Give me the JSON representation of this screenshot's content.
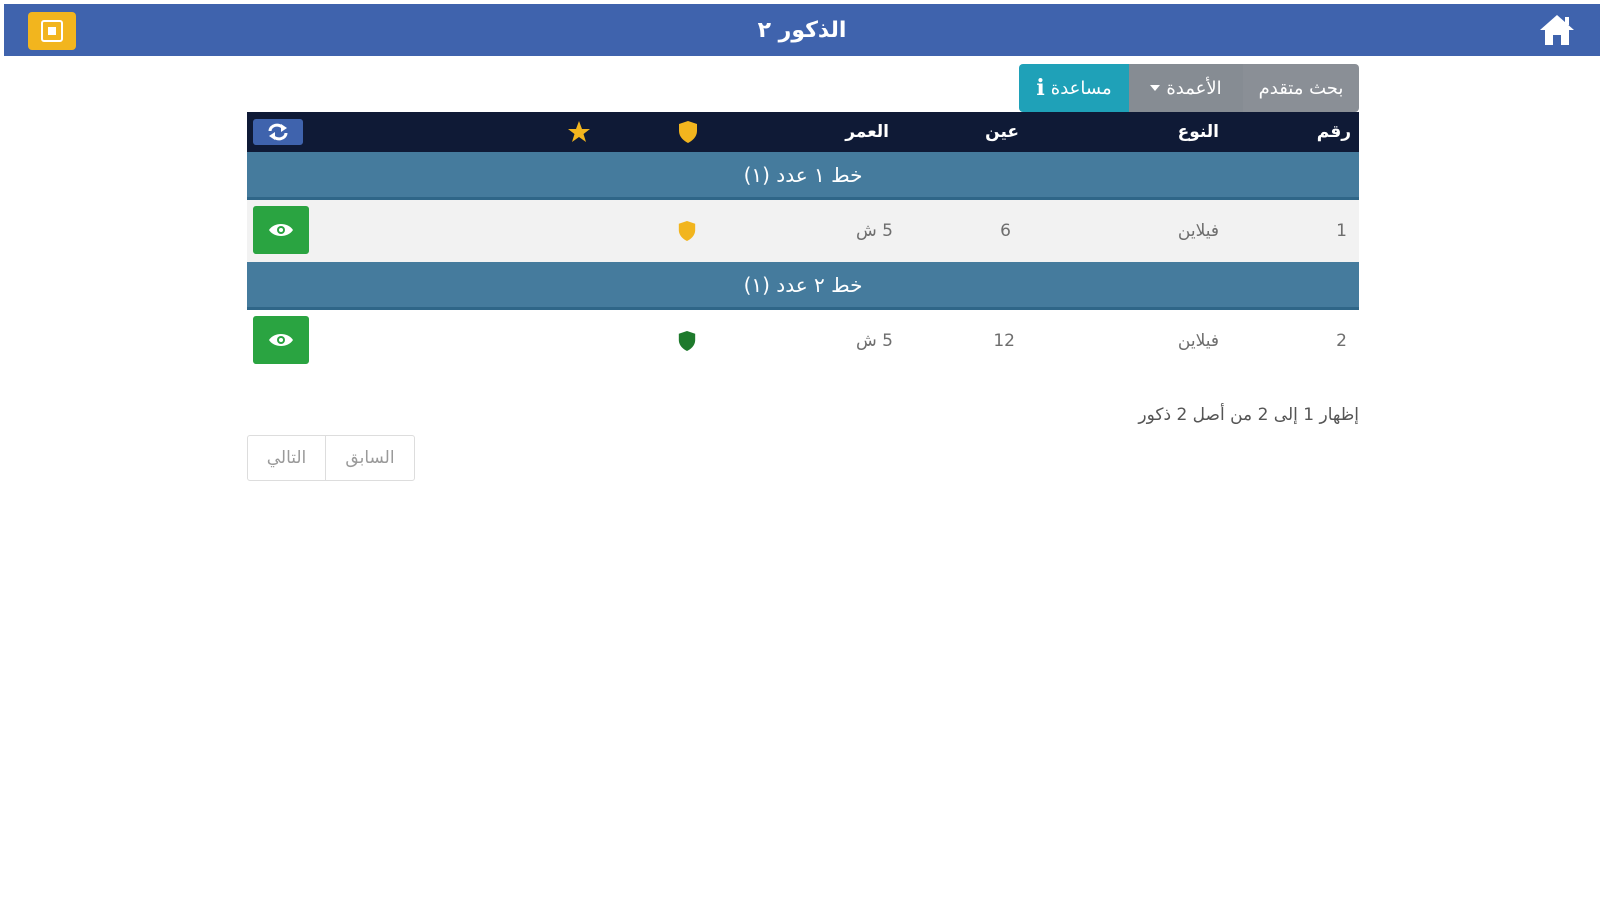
{
  "header": {
    "title": "الذكور ٢",
    "home_icon": "home-icon",
    "menu_icon": "menu-square-icon",
    "bg_color": "#3f63ad",
    "menu_color": "#f2b51e"
  },
  "toolbar": {
    "search_label": "بحث متقدم",
    "columns_label": "الأعمدة",
    "help_label": "مساعدة",
    "help_icon": "info-icon",
    "help_color": "#1fa1b8"
  },
  "table": {
    "headers": {
      "number": "رقم",
      "type": "النوع",
      "eye": "عين",
      "age": "العمر"
    },
    "header_icons": [
      "shield-icon",
      "star-icon",
      "refresh-icon"
    ],
    "groups": [
      {
        "label": "خط ١ عدد (١)",
        "row": {
          "number": "1",
          "type": "فيلاين",
          "eye": "6",
          "age": "5 ش",
          "shield_color": "#f2b51e"
        }
      },
      {
        "label": "خط ٢ عدد (١)",
        "row": {
          "number": "2",
          "type": "فيلاين",
          "eye": "12",
          "age": "5 ش",
          "shield_color": "#1e7a2c"
        }
      }
    ]
  },
  "footer": {
    "summary": "إظهار 1 إلى 2 من أصل 2 ذكور",
    "prev_label": "السابق",
    "next_label": "التالي"
  }
}
